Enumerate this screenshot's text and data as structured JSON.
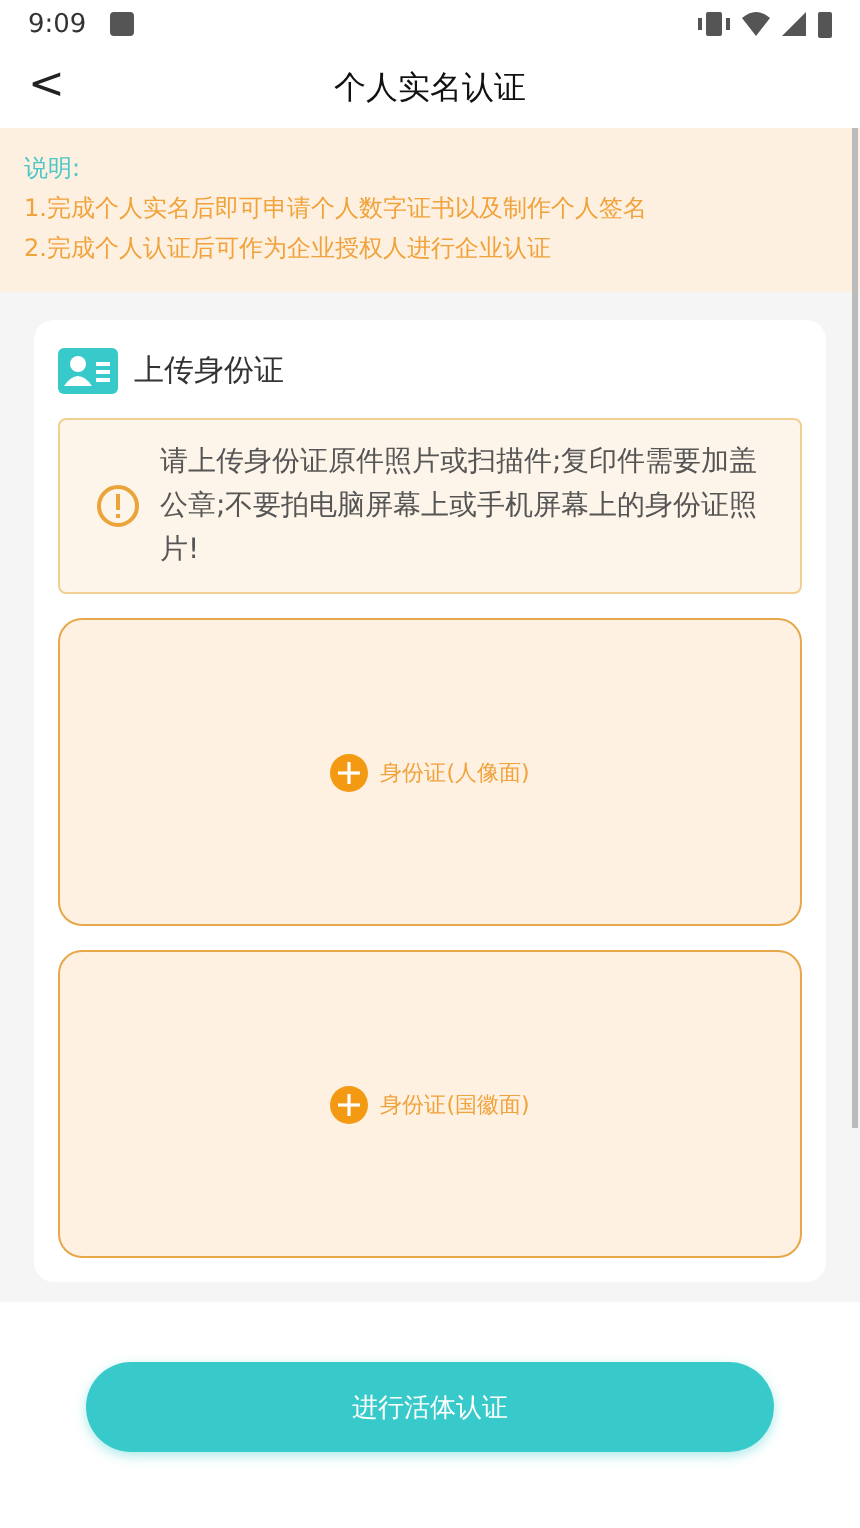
{
  "status_bar": {
    "time": "9:09"
  },
  "header": {
    "back": "<",
    "title": "个人实名认证"
  },
  "notice": {
    "heading": "说明:",
    "lines": [
      "1.完成个人实名后即可申请个人数字证书以及制作个人签名",
      "2.完成个人认证后可作为企业授权人进行企业认证"
    ]
  },
  "card": {
    "title": "上传身份证",
    "warning": "请上传身份证原件照片或扫描件;复印件需要加盖公章;不要拍电脑屏幕上或手机屏幕上的身份证照片!",
    "uploads": [
      {
        "label": "身份证(人像面)"
      },
      {
        "label": "身份证(国徽面)"
      }
    ]
  },
  "button": {
    "label": "进行活体认证"
  }
}
